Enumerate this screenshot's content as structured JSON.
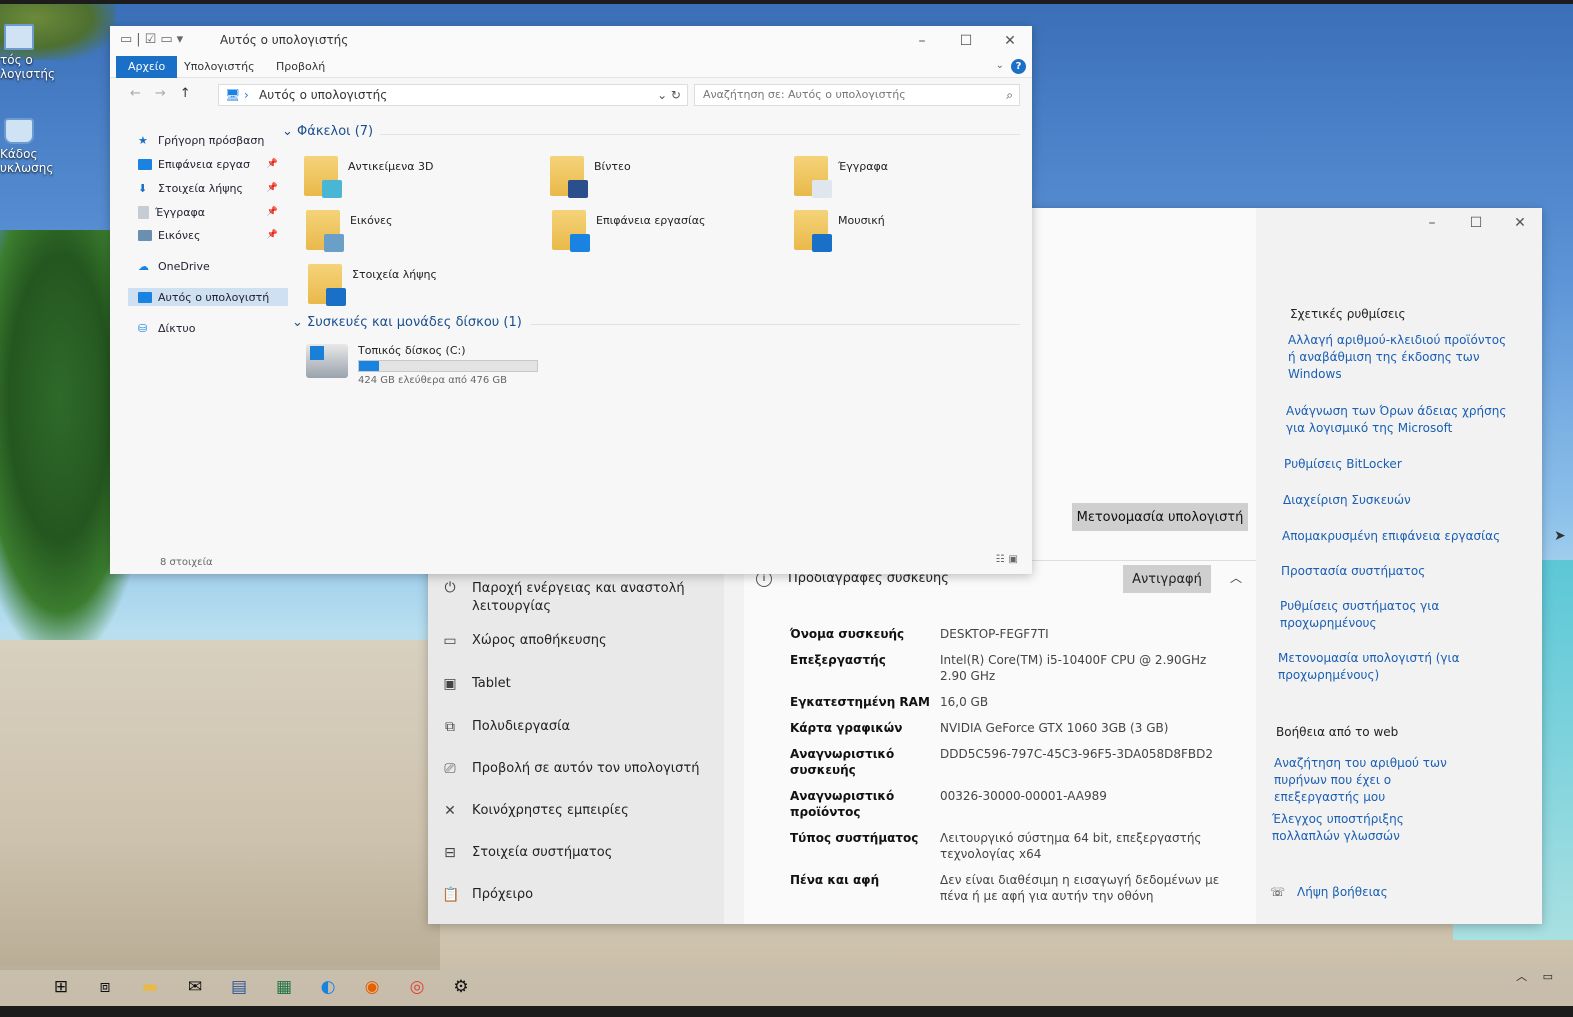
{
  "desktop": {
    "icons": [
      {
        "label": "τός ο\nλογιστής",
        "icon": "computer-icon"
      },
      {
        "label": "Κάδος\nυκλωσης",
        "icon": "recycle-bin-icon"
      }
    ]
  },
  "explorer": {
    "title": "Αυτός ο υπολογιστής",
    "ribbon_tabs": [
      "Αρχείο",
      "Υπολογιστής",
      "Προβολή"
    ],
    "address": "Αυτός ο υπολογιστής",
    "search_placeholder": "Αναζήτηση σε: Αυτός ο υπολογιστής",
    "sidebar": [
      {
        "label": "Γρήγορη πρόσβαση",
        "icon": "star-icon",
        "color": "#1a6fc6"
      },
      {
        "label": "Επιφάνεια εργασ",
        "icon": "desktop-icon",
        "color": "#1a82e0",
        "pinned": true
      },
      {
        "label": "Στοιχεία λήψης",
        "icon": "download-icon",
        "color": "#1a6fc6",
        "pinned": true
      },
      {
        "label": "Έγγραφα",
        "icon": "document-icon",
        "color": "#9aa3ad",
        "pinned": true
      },
      {
        "label": "Εικόνες",
        "icon": "pictures-icon",
        "color": "#6b8fb0",
        "pinned": true
      },
      {
        "label": "OneDrive",
        "icon": "cloud-icon",
        "color": "#1a82e0"
      },
      {
        "label": "Αυτός ο υπολογιστή",
        "icon": "computer-icon",
        "color": "#1a82e0",
        "selected": true
      },
      {
        "label": "Δίκτυο",
        "icon": "network-icon",
        "color": "#1a82e0"
      }
    ],
    "folders_title": "Φάκελοι (7)",
    "folders": [
      {
        "label": "Αντικείμενα 3D",
        "overlay": "#49b6d6"
      },
      {
        "label": "Βίντεο",
        "overlay": "#2a4f8c"
      },
      {
        "label": "Έγγραφα",
        "overlay": "#dfe6ee"
      },
      {
        "label": "Εικόνες",
        "overlay": "#6aa0c8"
      },
      {
        "label": "Επιφάνεια εργασίας",
        "overlay": "#1a82e0"
      },
      {
        "label": "Μουσική",
        "overlay": "#1a6fc6"
      },
      {
        "label": "Στοιχεία λήψης",
        "overlay": "#1a6fc6"
      }
    ],
    "devices_title": "Συσκευές και μονάδες δίσκου (1)",
    "drive": {
      "label": "Τοπικός δίσκος (C:)",
      "free_text": "424 GB ελεύθερα από 476 GB",
      "used_fraction": 0.11
    },
    "status": "8 στοιχεία"
  },
  "settings": {
    "nav": [
      {
        "label": "Παροχή ενέργειας και αναστολή λειτουργίας",
        "icon": "power-icon"
      },
      {
        "label": "Χώρος αποθήκευσης",
        "icon": "storage-icon"
      },
      {
        "label": "Tablet",
        "icon": "tablet-icon"
      },
      {
        "label": "Πολυδιεργασία",
        "icon": "multitasking-icon"
      },
      {
        "label": "Προβολή σε αυτόν τον υπολογιστή",
        "icon": "projecting-icon"
      },
      {
        "label": "Κοινόχρηστες εμπειρίες",
        "icon": "shared-experiences-icon"
      },
      {
        "label": "Στοιχεία συστήματος",
        "icon": "components-icon"
      },
      {
        "label": "Πρόχειρο",
        "icon": "clipboard-icon"
      }
    ],
    "rename_button": "Μετονομασία υπολογιστή",
    "specs_title": "Προδιαγραφές συσκευής",
    "copy_button": "Αντιγραφή",
    "specs": [
      {
        "k": "Όνομα συσκευής",
        "v": "DESKTOP-FEGF7TI"
      },
      {
        "k": "Επεξεργαστής",
        "v": "Intel(R) Core(TM) i5-10400F CPU @ 2.90GHz 2.90 GHz"
      },
      {
        "k": "Εγκατεστημένη RAM",
        "v": "16,0 GB"
      },
      {
        "k": "Κάρτα γραφικών",
        "v": "NVIDIA GeForce GTX 1060 3GB (3 GB)"
      },
      {
        "k": "Αναγνωριστικό συσκευής",
        "v": "DDD5C596-797C-45C3-96F5-3DA058D8FBD2"
      },
      {
        "k": "Αναγνωριστικό προϊόντος",
        "v": "00326-30000-00001-AA989"
      },
      {
        "k": "Τύπος συστήματος",
        "v": "Λειτουργικό σύστημα 64 bit, επεξεργαστής τεχνολογίας x64"
      },
      {
        "k": "Πένα και αφή",
        "v": "Δεν είναι διαθέσιμη η εισαγωγή δεδομένων με πένα ή με αφή για αυτήν την οθόνη"
      }
    ],
    "related_title": "Σχετικές ρυθμίσεις",
    "related_links": [
      "Αλλαγή αριθμού-κλειδιού προϊόντος ή αναβάθμιση της έκδοσης των Windows",
      "Ανάγνωση των Όρων άδειας χρήσης για λογισμικό της Microsoft",
      "Ρυθμίσεις BitLocker",
      "Διαχείριση Συσκευών",
      "Απομακρυσμένη επιφάνεια εργασίας",
      "Προστασία συστήματος",
      "Ρυθμίσεις συστήματος για προχωρημένους",
      "Μετονομασία υπολογιστή (για προχωρημένους)"
    ],
    "web_help_title": "Βοήθεια από το web",
    "web_links": [
      "Αναζήτηση του αριθμού των πυρήνων που έχει ο επεξεργαστής μου",
      "Έλεγχος υποστήριξης πολλαπλών γλωσσών"
    ],
    "get_help": "Λήψη βοήθειας"
  },
  "taskbar": {
    "items": [
      "windows-start-icon",
      "task-view-icon",
      "file-explorer-icon",
      "mail-icon",
      "word-icon",
      "excel-icon",
      "edge-icon",
      "firefox-icon",
      "chrome-icon",
      "settings-gear-icon"
    ]
  }
}
